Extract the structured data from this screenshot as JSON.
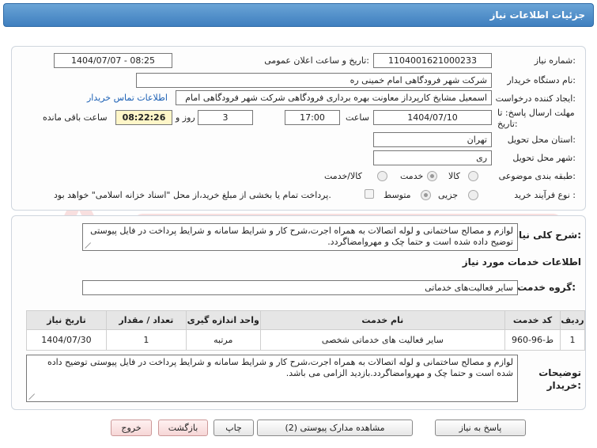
{
  "header": {
    "title": "جزئیات اطلاعات نیاز"
  },
  "form": {
    "need_number": {
      "label": "شماره نیاز:",
      "value": "1104001621000233"
    },
    "announce_datetime": {
      "label": "تاریخ و ساعت اعلان عمومی:",
      "value": "1404/07/07 - 08:25"
    },
    "buyer_org": {
      "label": "نام دستگاه خریدار:",
      "value": "شرکت شهر فرودگاهی امام خمینی  ره"
    },
    "requester": {
      "label": "ایجاد کننده درخواست:",
      "value": "اسمعیل مشایخ کارپرداز معاونت بهره برداری فرودگاهی شرکت شهر فرودگاهی امام"
    },
    "contact_link": "اطلاعات تماس خریدار",
    "deadline": {
      "label": "مهلت ارسال پاسخ: تا تاریخ:",
      "date": "1404/07/10",
      "time_label": "ساعت",
      "time": "17:00",
      "days": "3",
      "days_label": "روز و",
      "remaining": "08:22:26",
      "remaining_label": "ساعت باقی مانده"
    },
    "province": {
      "label": "استان محل تحویل:",
      "value": "تهران"
    },
    "city": {
      "label": "شهر محل تحویل:",
      "value": "ری"
    },
    "category": {
      "label": "طبقه بندی موضوعی:",
      "options": [
        "کالا",
        "خدمت",
        "کالا/خدمت"
      ],
      "selected": "خدمت"
    },
    "process_type": {
      "label": "نوع فرآیند خرید :",
      "options": [
        "جزیی",
        "متوسط"
      ],
      "selected": "متوسط",
      "payment_note": "پرداخت تمام یا بخشی از مبلغ خرید،از محل \"اسناد خزانه اسلامی\" خواهد بود."
    }
  },
  "details": {
    "summary_label": "شرح کلی نیاز:",
    "summary": "لوازم و مصالح ساختمانی و لوله اتصالات به همراه اجرت،شرح کار و شرایط سامانه و شرایط پرداخت در فایل پیوستی توضیح داده شده است و حتما چک و مهروامضاگردد.",
    "services_heading": "اطلاعات خدمات مورد نیاز",
    "service_group_label": "گروه خدمت:",
    "service_group": "سایر فعالیت‌های خدماتی",
    "table": {
      "headers": [
        "ردیف",
        "کد خدمت",
        "نام خدمت",
        "واحد اندازه گیری",
        "تعداد / مقدار",
        "تاریخ نیاز"
      ],
      "rows": [
        [
          "1",
          "ط-96-960",
          "سایر فعالیت های خدماتی شخصی",
          "مرتبه",
          "1",
          "1404/07/30"
        ]
      ]
    },
    "buyer_notes_label": "توضیحات خریدار:",
    "buyer_notes": "لوازم و مصالح ساختمانی و لوله اتصالات به همراه اجرت،شرح کار و شرایط سامانه و شرایط پرداخت در فایل پیوستی توضیح داده شده است و حتما چک و مهروامضاگردد.بازدید الزامی می باشد."
  },
  "buttons": {
    "reply": "پاسخ به نیاز",
    "attachments": "مشاهده مدارک پیوستی (2)",
    "print": "چاپ",
    "back": "بازگشت",
    "exit": "خروج"
  },
  "colors": {
    "title_bar": "#3f7fbf",
    "link": "#1a5fb4",
    "remaining_bg": "#fff6c8"
  }
}
